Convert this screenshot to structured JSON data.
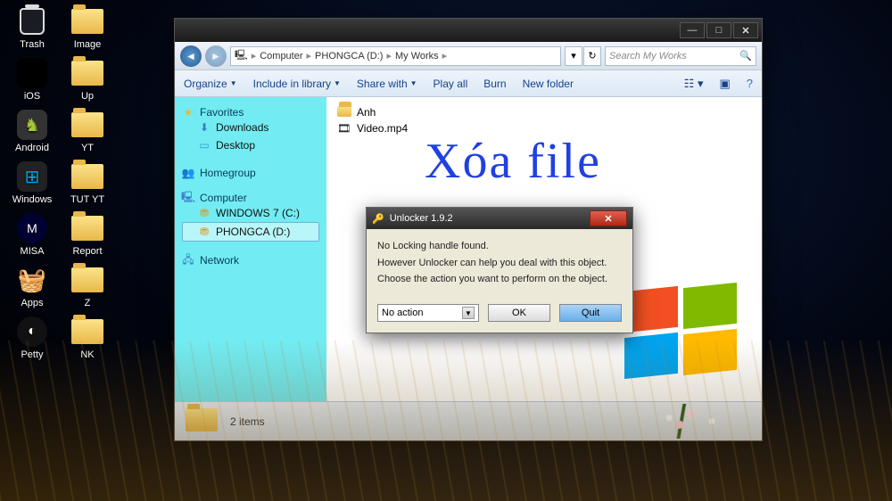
{
  "desktop_icons_col1": [
    {
      "label": "Trash",
      "type": "trash"
    },
    {
      "label": "iOS",
      "type": "apple"
    },
    {
      "label": "Android",
      "type": "android"
    },
    {
      "label": "Windows",
      "type": "win"
    },
    {
      "label": "MISA",
      "type": "misa"
    },
    {
      "label": "Apps",
      "type": "basket"
    },
    {
      "label": "Petty",
      "type": "petty"
    }
  ],
  "desktop_icons_col2": [
    {
      "label": "Image",
      "type": "folder"
    },
    {
      "label": "Up",
      "type": "folder"
    },
    {
      "label": "YT",
      "type": "folder"
    },
    {
      "label": "TUT YT",
      "type": "folder"
    },
    {
      "label": "Report",
      "type": "folder"
    },
    {
      "label": "Z",
      "type": "folder"
    },
    {
      "label": "NK",
      "type": "folder"
    }
  ],
  "explorer": {
    "breadcrumb": [
      "Computer",
      "PHONGCA (D:)",
      "My Works"
    ],
    "search_placeholder": "Search My Works",
    "toolbar": {
      "organize": "Organize",
      "include": "Include in library",
      "share": "Share with",
      "play": "Play all",
      "burn": "Burn",
      "newfolder": "New folder"
    },
    "sidebar": {
      "favorites": {
        "label": "Favorites",
        "items": [
          "Downloads",
          "Desktop"
        ]
      },
      "homegroup": {
        "label": "Homegroup"
      },
      "computer": {
        "label": "Computer",
        "items": [
          "WINDOWS 7 (C:)",
          "PHONGCA (D:)"
        ],
        "selected": 1
      },
      "network": {
        "label": "Network"
      }
    },
    "files": [
      {
        "name": "Anh",
        "kind": "folder"
      },
      {
        "name": "Video.mp4",
        "kind": "video"
      }
    ],
    "status_text": "2 items",
    "watermark": "Xóa file"
  },
  "dialog": {
    "title": "Unlocker 1.9.2",
    "line1": "No Locking handle found.",
    "line2": "However Unlocker can help you deal with this object.",
    "line3": "Choose the action you want to perform on the object.",
    "combo_value": "No action",
    "ok": "OK",
    "quit": "Quit"
  }
}
